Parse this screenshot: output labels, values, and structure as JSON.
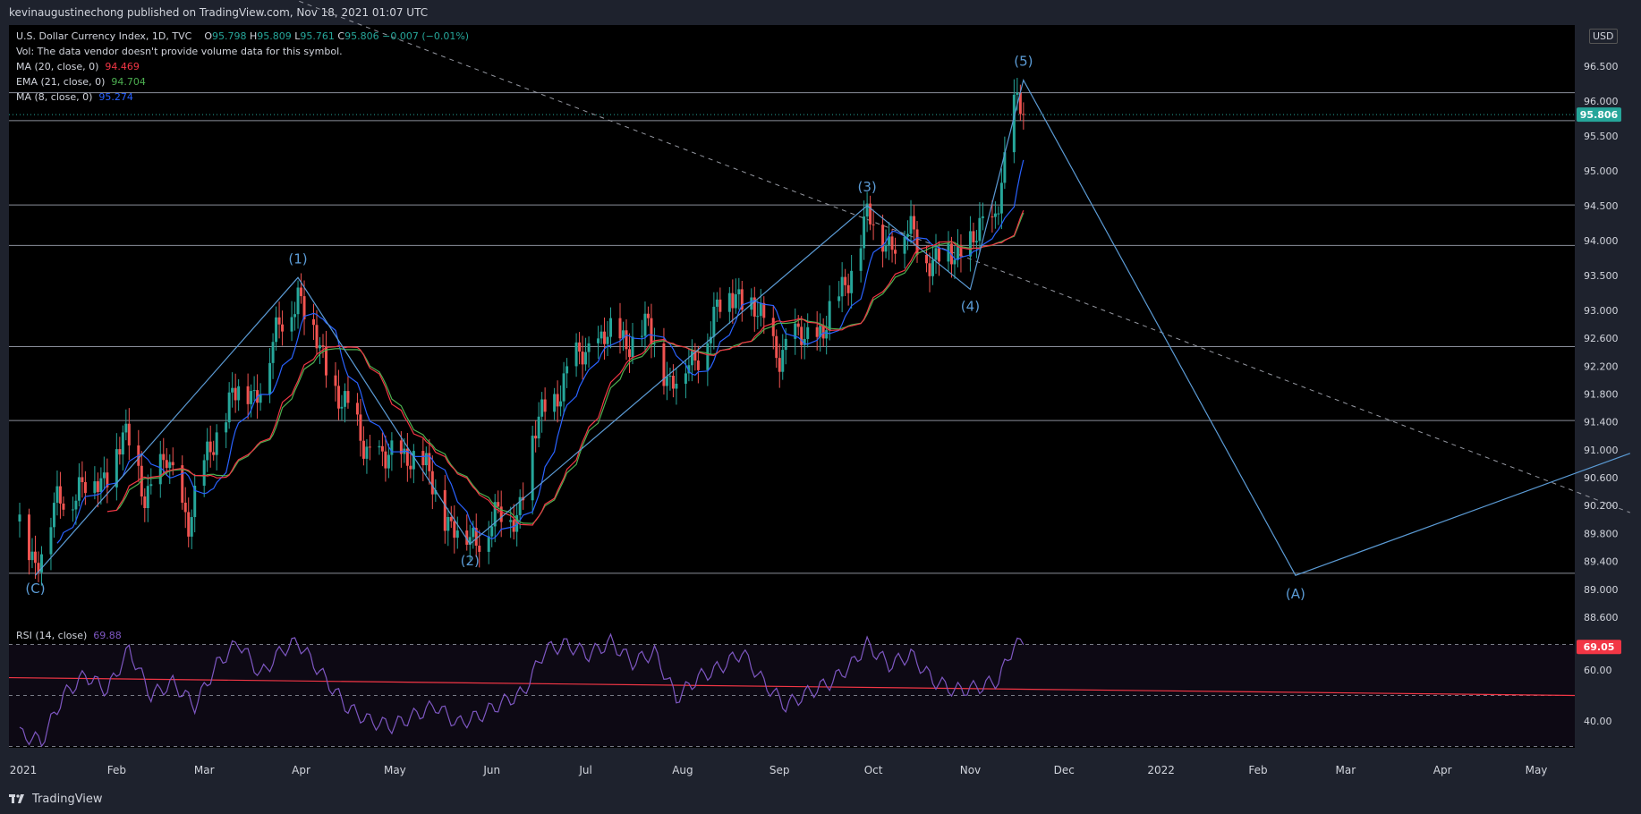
{
  "header": {
    "publisher": "kevinaugustinechong published on TradingView.com, Nov 18, 2021 01:07 UTC"
  },
  "symbol": {
    "name": "U.S. Dollar Currency Index, 1D, TVC",
    "o_label": "O",
    "o_value": "95.798",
    "h_label": "H",
    "h_value": "95.809",
    "l_label": "L",
    "l_value": "95.761",
    "c_label": "C",
    "c_value": "95.806",
    "change": "−0.007 (−0.01%)",
    "volume_note": "Vol: The data vendor doesn't provide volume data for this symbol."
  },
  "indicators": [
    {
      "label": "MA (20, close, 0)",
      "value": "94.469",
      "color": "#f23645"
    },
    {
      "label": "EMA (21, close, 0)",
      "value": "94.704",
      "color": "#4caf50"
    },
    {
      "label": "MA (8, close, 0)",
      "value": "95.274",
      "color": "#2962ff"
    }
  ],
  "currency_badge": "USD",
  "price_badge": "95.806",
  "rsi": {
    "label": "RSI (14, close)",
    "value": "69.88",
    "badge": "69.05",
    "ticks": [
      "60.00",
      "40.00"
    ]
  },
  "colors": {
    "up": "#26a69a",
    "down": "#ef5350",
    "wave": "#5b9bd5",
    "rsi": "#7e57c2",
    "price_badge": "#26a69a",
    "rsi_badge": "#f23645"
  },
  "footer": {
    "brand": "TradingView"
  },
  "chart_data": {
    "type": "candlestick",
    "title": "U.S. Dollar Currency Index, 1D, TVC",
    "price_axis_ticks": [
      "96.500",
      "96.000",
      "95.500",
      "95.000",
      "94.500",
      "94.000",
      "93.500",
      "93.000",
      "92.600",
      "92.200",
      "91.800",
      "91.400",
      "91.000",
      "90.600",
      "90.200",
      "89.800",
      "89.400",
      "89.000",
      "88.600"
    ],
    "time_axis_ticks": [
      "2021",
      "Feb",
      "Mar",
      "Apr",
      "May",
      "Jun",
      "Jul",
      "Aug",
      "Sep",
      "Oct",
      "Nov",
      "Dec",
      "2022",
      "Feb",
      "Mar",
      "Apr",
      "May"
    ],
    "horizontal_levels": [
      96.12,
      95.72,
      94.51,
      93.93,
      92.48,
      91.42,
      89.23
    ],
    "wave_labels": [
      {
        "label": "(C)",
        "date": "2021-01-06",
        "price": 89.2
      },
      {
        "label": "(1)",
        "date": "2021-03-31",
        "price": 93.47
      },
      {
        "label": "(2)",
        "date": "2021-05-25",
        "price": 89.65
      },
      {
        "label": "(3)",
        "date": "2021-09-29",
        "price": 94.5
      },
      {
        "label": "(4)",
        "date": "2021-11-01",
        "price": 93.3
      },
      {
        "label": "(5)",
        "date": "2021-11-18",
        "price": 96.3
      },
      {
        "label": "(A)",
        "date": "2022-02-13",
        "price": 89.2
      }
    ],
    "projection_end": {
      "date": "2022-05-31",
      "price": 90.95
    },
    "dashed_trendline": [
      {
        "date": "2021-03-10",
        "price": 97.8
      },
      {
        "date": "2022-05-31",
        "price": 90.1
      }
    ],
    "close_path_anchors": [
      {
        "date": "2021-01-01",
        "price": 89.9
      },
      {
        "date": "2021-01-06",
        "price": 89.4
      },
      {
        "date": "2021-01-13",
        "price": 90.2
      },
      {
        "date": "2021-01-20",
        "price": 90.5
      },
      {
        "date": "2021-01-27",
        "price": 90.5
      },
      {
        "date": "2021-02-03",
        "price": 91.2
      },
      {
        "date": "2021-02-10",
        "price": 90.4
      },
      {
        "date": "2021-02-17",
        "price": 90.8
      },
      {
        "date": "2021-02-24",
        "price": 90.0
      },
      {
        "date": "2021-03-03",
        "price": 91.0
      },
      {
        "date": "2021-03-10",
        "price": 91.8
      },
      {
        "date": "2021-03-17",
        "price": 91.8
      },
      {
        "date": "2021-03-24",
        "price": 92.6
      },
      {
        "date": "2021-03-31",
        "price": 93.3
      },
      {
        "date": "2021-04-07",
        "price": 92.4
      },
      {
        "date": "2021-04-14",
        "price": 91.7
      },
      {
        "date": "2021-04-21",
        "price": 91.1
      },
      {
        "date": "2021-04-28",
        "price": 90.8
      },
      {
        "date": "2021-05-05",
        "price": 91.0
      },
      {
        "date": "2021-05-12",
        "price": 90.6
      },
      {
        "date": "2021-05-19",
        "price": 89.9
      },
      {
        "date": "2021-05-25",
        "price": 89.7
      },
      {
        "date": "2021-06-02",
        "price": 90.0
      },
      {
        "date": "2021-06-09",
        "price": 90.1
      },
      {
        "date": "2021-06-16",
        "price": 91.4
      },
      {
        "date": "2021-06-23",
        "price": 91.9
      },
      {
        "date": "2021-06-30",
        "price": 92.4
      },
      {
        "date": "2021-07-07",
        "price": 92.6
      },
      {
        "date": "2021-07-14",
        "price": 92.6
      },
      {
        "date": "2021-07-21",
        "price": 92.7
      },
      {
        "date": "2021-07-28",
        "price": 92.0
      },
      {
        "date": "2021-08-04",
        "price": 92.2
      },
      {
        "date": "2021-08-11",
        "price": 92.9
      },
      {
        "date": "2021-08-18",
        "price": 93.3
      },
      {
        "date": "2021-08-25",
        "price": 92.9
      },
      {
        "date": "2021-09-01",
        "price": 92.4
      },
      {
        "date": "2021-09-08",
        "price": 92.6
      },
      {
        "date": "2021-09-15",
        "price": 92.7
      },
      {
        "date": "2021-09-22",
        "price": 93.4
      },
      {
        "date": "2021-09-29",
        "price": 94.3
      },
      {
        "date": "2021-10-06",
        "price": 94.0
      },
      {
        "date": "2021-10-13",
        "price": 94.1
      },
      {
        "date": "2021-10-20",
        "price": 93.7
      },
      {
        "date": "2021-10-27",
        "price": 93.8
      },
      {
        "date": "2021-11-01",
        "price": 94.0
      },
      {
        "date": "2021-11-08",
        "price": 94.2
      },
      {
        "date": "2021-11-15",
        "price": 95.9
      },
      {
        "date": "2021-11-18",
        "price": 95.806
      }
    ],
    "rsi_path_anchors": [
      {
        "date": "2021-01-01",
        "value": 35
      },
      {
        "date": "2021-01-08",
        "value": 32
      },
      {
        "date": "2021-01-15",
        "value": 50
      },
      {
        "date": "2021-01-22",
        "value": 58
      },
      {
        "date": "2021-01-29",
        "value": 52
      },
      {
        "date": "2021-02-05",
        "value": 68
      },
      {
        "date": "2021-02-12",
        "value": 50
      },
      {
        "date": "2021-02-19",
        "value": 55
      },
      {
        "date": "2021-02-26",
        "value": 46
      },
      {
        "date": "2021-03-05",
        "value": 62
      },
      {
        "date": "2021-03-12",
        "value": 71
      },
      {
        "date": "2021-03-19",
        "value": 58
      },
      {
        "date": "2021-03-26",
        "value": 68
      },
      {
        "date": "2021-03-31",
        "value": 71
      },
      {
        "date": "2021-04-09",
        "value": 56
      },
      {
        "date": "2021-04-16",
        "value": 45
      },
      {
        "date": "2021-04-23",
        "value": 40
      },
      {
        "date": "2021-04-30",
        "value": 38
      },
      {
        "date": "2021-05-07",
        "value": 42
      },
      {
        "date": "2021-05-14",
        "value": 46
      },
      {
        "date": "2021-05-21",
        "value": 39
      },
      {
        "date": "2021-05-28",
        "value": 42
      },
      {
        "date": "2021-06-04",
        "value": 47
      },
      {
        "date": "2021-06-11",
        "value": 51
      },
      {
        "date": "2021-06-18",
        "value": 68
      },
      {
        "date": "2021-06-25",
        "value": 70
      },
      {
        "date": "2021-07-02",
        "value": 66
      },
      {
        "date": "2021-07-09",
        "value": 71
      },
      {
        "date": "2021-07-16",
        "value": 63
      },
      {
        "date": "2021-07-23",
        "value": 67
      },
      {
        "date": "2021-07-30",
        "value": 49
      },
      {
        "date": "2021-08-06",
        "value": 57
      },
      {
        "date": "2021-08-13",
        "value": 61
      },
      {
        "date": "2021-08-20",
        "value": 67
      },
      {
        "date": "2021-08-27",
        "value": 55
      },
      {
        "date": "2021-09-03",
        "value": 46
      },
      {
        "date": "2021-09-10",
        "value": 51
      },
      {
        "date": "2021-09-17",
        "value": 55
      },
      {
        "date": "2021-09-24",
        "value": 62
      },
      {
        "date": "2021-09-29",
        "value": 70
      },
      {
        "date": "2021-10-06",
        "value": 62
      },
      {
        "date": "2021-10-13",
        "value": 66
      },
      {
        "date": "2021-10-20",
        "value": 56
      },
      {
        "date": "2021-10-27",
        "value": 52
      },
      {
        "date": "2021-11-03",
        "value": 53
      },
      {
        "date": "2021-11-10",
        "value": 56
      },
      {
        "date": "2021-11-15",
        "value": 70
      },
      {
        "date": "2021-11-18",
        "value": 69.88
      }
    ],
    "rsi_signal_line": [
      {
        "date": "2021-01-01",
        "value": 57
      },
      {
        "date": "2022-05-31",
        "value": 50
      }
    ]
  }
}
